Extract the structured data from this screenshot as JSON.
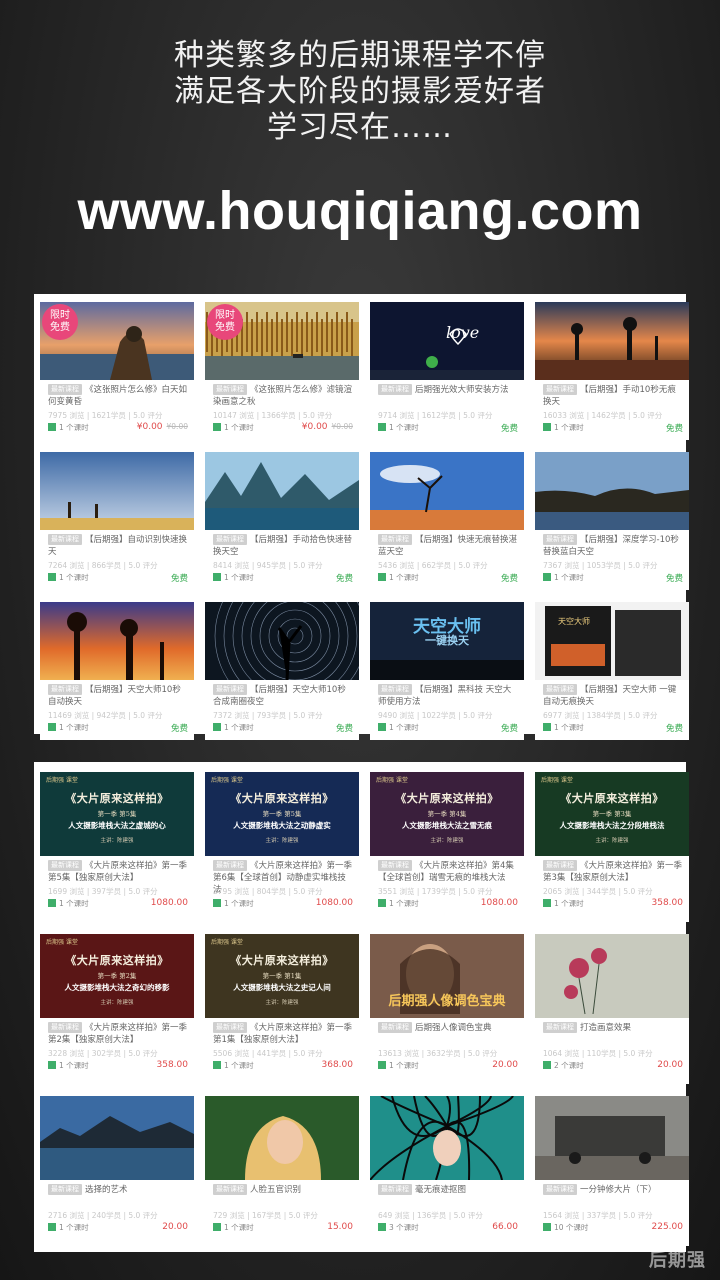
{
  "headline": {
    "line1": "种类繁多的后期课程学不停",
    "line2": "满足各大阶段的摄影爱好者",
    "line3": "学习尽在……",
    "url": "www.houqiqiang.com"
  },
  "panel1": {
    "cards": [
      {
        "badge": [
          "限时",
          "免费"
        ],
        "tag": "最新课程",
        "title": "《这张照片怎么修》白天如何变黄昏",
        "stats": "7975 浏览 | 1621学员 | 5.0 评分",
        "lessons": "1 个课时",
        "price": "¥0.00",
        "old_price": "¥0.00",
        "thumb": "dusk-boy"
      },
      {
        "badge": [
          "限时",
          "免费"
        ],
        "tag": "最新课程",
        "title": "《这张照片怎么修》滤镜渲染画意之秋",
        "stats": "10147 浏览 | 1366学员 | 5.0 评分",
        "lessons": "1 个课时",
        "price": "¥0.00",
        "old_price": "¥0.00",
        "thumb": "autumn-reeds"
      },
      {
        "badge": null,
        "tag": "最新课程",
        "title": "后期强光效大师安装方法",
        "stats": "9714 浏览 | 1612学员 | 5.0 评分",
        "lessons": "1 个课时",
        "price": "免费",
        "old_price": "",
        "thumb": "love-light"
      },
      {
        "badge": null,
        "tag": "最新课程",
        "title": "【后期强】手动10秒无痕换天",
        "stats": "16033 浏览 | 1462学员 | 5.0 评分",
        "lessons": "1 个课时",
        "price": "免费",
        "old_price": "",
        "thumb": "baobab-sunset"
      },
      {
        "badge": null,
        "tag": "最新课程",
        "title": "【后期强】自动识别快速换天",
        "stats": "7264 浏览 | 866学员 | 5.0 评分",
        "lessons": "1 个课时",
        "price": "免费",
        "old_price": "",
        "thumb": "giraffes"
      },
      {
        "badge": null,
        "tag": "最新课程",
        "title": "【后期强】手动拾色快速替换天空",
        "stats": "8414 浏览 | 945学员 | 5.0 评分",
        "lessons": "1 个课时",
        "price": "免费",
        "old_price": "",
        "thumb": "karst-river"
      },
      {
        "badge": null,
        "tag": "最新课程",
        "title": "【后期强】快速无痕替换湛蓝天空",
        "stats": "5436 浏览 | 662学员 | 5.0 评分",
        "lessons": "1 个课时",
        "price": "免费",
        "old_price": "",
        "thumb": "desert-tree"
      },
      {
        "badge": null,
        "tag": "最新课程",
        "title": "【后期强】深度学习-10秒替换蓝白天空",
        "stats": "7367 浏览 | 1053学员 | 5.0 评分",
        "lessons": "1 个课时",
        "price": "免费",
        "old_price": "",
        "thumb": "rocky-coast"
      },
      {
        "badge": null,
        "tag": "最新课程",
        "title": "【后期强】天空大师10秒自动换天",
        "stats": "11469 浏览 | 942学员 | 5.0 评分",
        "lessons": "1 个课时",
        "price": "免费",
        "old_price": "",
        "thumb": "baobab-orange"
      },
      {
        "badge": null,
        "tag": "最新课程",
        "title": "【后期强】天空大师10秒合成南圈夜空",
        "stats": "7372 浏览 | 793学员 | 5.0 评分",
        "lessons": "1 个课时",
        "price": "免费",
        "old_price": "",
        "thumb": "star-trails"
      },
      {
        "badge": null,
        "tag": "最新课程",
        "title": "【后期强】黑科技 天空大师使用方法",
        "stats": "9490 浏览 | 1022学员 | 5.0 评分",
        "lessons": "1 个课时",
        "price": "免费",
        "old_price": "",
        "thumb": "sky-master",
        "thumb_text": [
          "天空大师",
          "一键换天"
        ]
      },
      {
        "badge": null,
        "tag": "最新课程",
        "title": "【后期强】天空大师 一键自动无痕换天",
        "stats": "6977 浏览 | 1384学员 | 5.0 评分",
        "lessons": "1 个课时",
        "price": "免费",
        "old_price": "",
        "thumb": "product-box",
        "thumb_text": [
          "天空大师"
        ]
      }
    ]
  },
  "panel2": {
    "book": {
      "logo": "后期强 课堂",
      "title": "《大片原来这样拍》",
      "author": "主讲：陈建强"
    },
    "cards": [
      {
        "tag": "最新课程",
        "title": "《大片原来这样拍》第一季第5集【独家原创大法】",
        "stats": "1699 浏览 | 397学员 | 5.0 评分",
        "lessons": "1 个课时",
        "price": "1080.00",
        "cover": {
          "sub": "第一季 第5集",
          "main": "人文摄影堆栈大法之虚城的心",
          "color": "#0f3a3a"
        }
      },
      {
        "tag": "最新课程",
        "title": "《大片原来这样拍》第一季第6集【全球首创】动静虚实堆栈技法",
        "stats": "2795 浏览 | 804学员 | 5.0 评分",
        "lessons": "1 个课时",
        "price": "1080.00",
        "cover": {
          "sub": "第一季 第5集",
          "main": "人文摄影堆栈大法之动静虚实",
          "color": "#152a55"
        }
      },
      {
        "tag": "最新课程",
        "title": "《大片原来这样拍》第4集【全球首创】瑞雪无痕的堆栈大法",
        "stats": "3551 浏览 | 1739学员 | 5.0 评分",
        "lessons": "1 个课时",
        "price": "1080.00",
        "cover": {
          "sub": "第一季 第4集",
          "main": "人文摄影堆栈大法之雪无痕",
          "color": "#3a1f3c"
        }
      },
      {
        "tag": "最新课程",
        "title": "《大片原来这样拍》第一季第3集【独家原创大法】",
        "stats": "2065 浏览 | 344学员 | 5.0 评分",
        "lessons": "1 个课时",
        "price": "358.00",
        "cover": {
          "sub": "第一季 第3集",
          "main": "人文摄影堆栈大法之分段堆栈法",
          "color": "#173a23"
        }
      },
      {
        "tag": "最新课程",
        "title": "《大片原来这样拍》第一季第2集【独家原创大法】",
        "stats": "3228 浏览 | 302学员 | 5.0 评分",
        "lessons": "1 个课时",
        "price": "358.00",
        "cover": {
          "sub": "第一季 第2集",
          "main": "人文摄影堆栈大法之奇幻的移影",
          "color": "#5a1616"
        }
      },
      {
        "tag": "最新课程",
        "title": "《大片原来这样拍》第一季第1集【独家原创大法】",
        "stats": "5506 浏览 | 441学员 | 5.0 评分",
        "lessons": "1 个课时",
        "price": "368.00",
        "cover": {
          "sub": "第一季 第1集",
          "main": "人文摄影堆栈大法之史记人间",
          "color": "#3e3520"
        }
      },
      {
        "tag": "最新课程",
        "title": "后期强人像调色宝典",
        "stats": "13613 浏览 | 3632学员 | 5.0 评分",
        "lessons": "1 个课时",
        "price": "20.00",
        "thumb": "portrait-book",
        "thumb_text": [
          "后期强人像调色宝典"
        ]
      },
      {
        "tag": "最新课程",
        "title": "打造画意效果",
        "stats": "1064 浏览 | 110学员 | 5.0 评分",
        "lessons": "2 个课时",
        "price": "20.00",
        "thumb": "flowers"
      },
      {
        "tag": "最新课程",
        "title": "选择的艺术",
        "stats": "2716 浏览 | 240学员 | 5.0 评分",
        "lessons": "1 个课时",
        "price": "20.00",
        "thumb": "mountain-lake"
      },
      {
        "tag": "最新课程",
        "title": "人脸五官识别",
        "stats": "729 浏览 | 167学员 | 5.0 评分",
        "lessons": "1 个课时",
        "price": "15.00",
        "thumb": "blonde-portrait"
      },
      {
        "tag": "最新课程",
        "title": "毫无痕迹抠图",
        "stats": "649 浏览 | 136学员 | 5.0 评分",
        "lessons": "3 个课时",
        "price": "66.00",
        "thumb": "hair-portrait"
      },
      {
        "tag": "最新课程",
        "title": "一分钟修大片（下）",
        "stats": "1564 浏览 | 337学员 | 5.0 评分",
        "lessons": "10 个课时",
        "price": "225.00",
        "thumb": "train-street"
      }
    ]
  },
  "watermark": "后期强"
}
